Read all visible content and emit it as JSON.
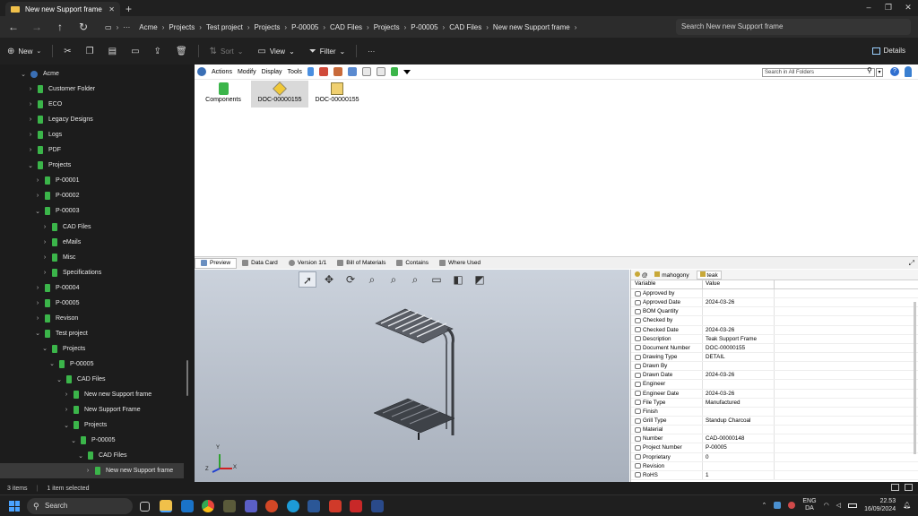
{
  "window": {
    "tab_title": "New new Support frame",
    "new_tab_symbol": "+",
    "controls": [
      "–",
      "❐",
      "✕"
    ]
  },
  "address": {
    "crumbs": [
      "Acme",
      "Projects",
      "Test project",
      "Projects",
      "P-00005",
      "CAD Files",
      "Projects",
      "P-00005",
      "CAD Files",
      "New new Support frame"
    ],
    "search_placeholder": "Search New new Support frame"
  },
  "commands": {
    "new": "New",
    "sort": "Sort",
    "view": "View",
    "filter": "Filter",
    "more": "···",
    "details": "Details"
  },
  "nav": {
    "items": [
      {
        "label": "Acme",
        "level": 1,
        "expanded": true,
        "root": true
      },
      {
        "label": "Customer Folder",
        "level": 2
      },
      {
        "label": "ECO",
        "level": 2
      },
      {
        "label": "Legacy Designs",
        "level": 2
      },
      {
        "label": "Logs",
        "level": 2
      },
      {
        "label": "PDF",
        "level": 2
      },
      {
        "label": "Projects",
        "level": 2,
        "expanded": true
      },
      {
        "label": "P-00001",
        "level": 3
      },
      {
        "label": "P-00002",
        "level": 3
      },
      {
        "label": "P-00003",
        "level": 3,
        "expanded": true
      },
      {
        "label": "CAD Files",
        "level": 4
      },
      {
        "label": "eMails",
        "level": 4
      },
      {
        "label": "Misc",
        "level": 4
      },
      {
        "label": "Specifications",
        "level": 4
      },
      {
        "label": "P-00004",
        "level": 3
      },
      {
        "label": "P-00005",
        "level": 3
      },
      {
        "label": "Revison",
        "level": 3
      },
      {
        "label": "Test project",
        "level": 3,
        "expanded": true
      },
      {
        "label": "Projects",
        "level": 4,
        "expanded": true
      },
      {
        "label": "P-00005",
        "level": 5,
        "expanded": true
      },
      {
        "label": "CAD Files",
        "level": 6,
        "expanded": true
      },
      {
        "label": "New new Support frame",
        "level": 7
      },
      {
        "label": "New Support Frame",
        "level": 7
      },
      {
        "label": "Projects",
        "level": 7,
        "expanded": true
      },
      {
        "label": "P-00005",
        "level": 8,
        "expanded": true
      },
      {
        "label": "CAD Files",
        "level": 9,
        "expanded": true
      },
      {
        "label": "New new Support frame",
        "level": 10,
        "selected": true
      }
    ]
  },
  "pdm": {
    "menus": [
      "Actions",
      "Modify",
      "Display",
      "Tools"
    ],
    "search_placeholder": "Search in All Folders",
    "files": [
      {
        "label": "Components",
        "kind": "folder"
      },
      {
        "label": "DOC-00000155",
        "kind": "assembly",
        "selected": true
      },
      {
        "label": "DOC-00000155",
        "kind": "drawing"
      }
    ]
  },
  "tabs": [
    "Preview",
    "Data Card",
    "Version 1/1",
    "Bill of Materials",
    "Contains",
    "Where Used"
  ],
  "datacard": {
    "configs": [
      "@",
      "mahogony",
      "teak"
    ],
    "col_variable": "Variable",
    "col_value": "Value",
    "rows": [
      {
        "variable": "Approved by",
        "value": ""
      },
      {
        "variable": "Approved Date",
        "value": "2024-03-26"
      },
      {
        "variable": "BOM Quantity",
        "value": ""
      },
      {
        "variable": "Checked by",
        "value": ""
      },
      {
        "variable": "Checked Date",
        "value": "2024-03-26"
      },
      {
        "variable": "Description",
        "value": "Teak Support Frame"
      },
      {
        "variable": "Document Number",
        "value": "DOC-00000155"
      },
      {
        "variable": "Drawing Type",
        "value": "DETAIL"
      },
      {
        "variable": "Drawn By",
        "value": ""
      },
      {
        "variable": "Drawn Date",
        "value": "2024-03-26"
      },
      {
        "variable": "Engineer",
        "value": ""
      },
      {
        "variable": "Engineer Date",
        "value": "2024-03-26"
      },
      {
        "variable": "File Type",
        "value": "Manufactured"
      },
      {
        "variable": "Finish",
        "value": ""
      },
      {
        "variable": "Grill Type",
        "value": "Standup Charcoal"
      },
      {
        "variable": "Material",
        "value": ""
      },
      {
        "variable": "Number",
        "value": "CAD-00000148"
      },
      {
        "variable": "Project Number",
        "value": "P-00005"
      },
      {
        "variable": "Proprietary",
        "value": "0"
      },
      {
        "variable": "Revision",
        "value": ""
      },
      {
        "variable": "RoHS",
        "value": "1"
      }
    ]
  },
  "triad": {
    "x": "X",
    "y": "Y",
    "z": "Z"
  },
  "status": {
    "items": "3 items",
    "selected": "1 item selected"
  },
  "taskbar": {
    "search": "Search",
    "lang_top": "ENG",
    "lang_bottom": "DA",
    "time": "22.53",
    "date": "16/09/2024"
  },
  "colors": {
    "folder_green": "#3bb54a",
    "accent": "#4aa3ff"
  }
}
